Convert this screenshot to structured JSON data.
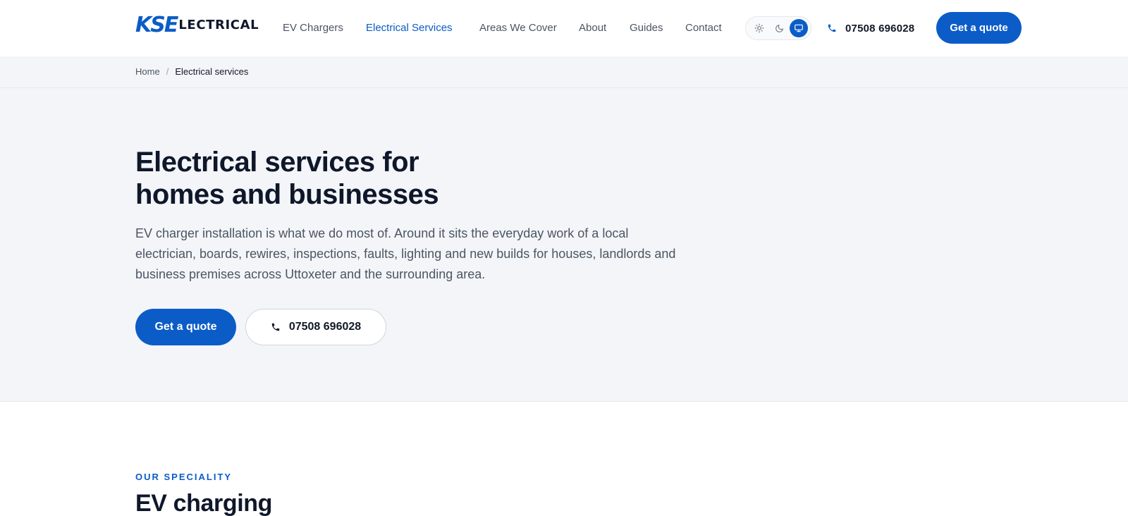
{
  "brand": {
    "logo_mark": "KSE",
    "logo_word": "LECTRICAL",
    "color": "#0b5cc7"
  },
  "nav": {
    "items": [
      {
        "label": "EV Chargers",
        "active": false
      },
      {
        "label": "Electrical Services",
        "active": true
      },
      {
        "label": "Areas We Cover",
        "active": false
      },
      {
        "label": "About",
        "active": false
      },
      {
        "label": "Guides",
        "active": false
      },
      {
        "label": "Contact",
        "active": false
      }
    ]
  },
  "theme_toggle": {
    "options": [
      "sun-icon",
      "moon-icon",
      "monitor-icon"
    ],
    "selected": "monitor-icon"
  },
  "header": {
    "phone": "07508 696028",
    "quote_label": "Get a quote"
  },
  "breadcrumb": {
    "home": "Home",
    "separator": "/",
    "current": "Electrical services"
  },
  "hero": {
    "title_line1": "Electrical services for",
    "title_line2": "homes and businesses",
    "text": "EV charger installation is what we do most of. Around it sits the everyday work of a local electrician, boards, rewires, inspections, faults, lighting and new builds for houses, landlords and business premises across Uttoxeter and the surrounding area.",
    "quote_label": "Get a quote",
    "phone": "07508 696028"
  },
  "speciality": {
    "eyebrow": "OUR SPECIALITY",
    "title": "EV charging"
  }
}
